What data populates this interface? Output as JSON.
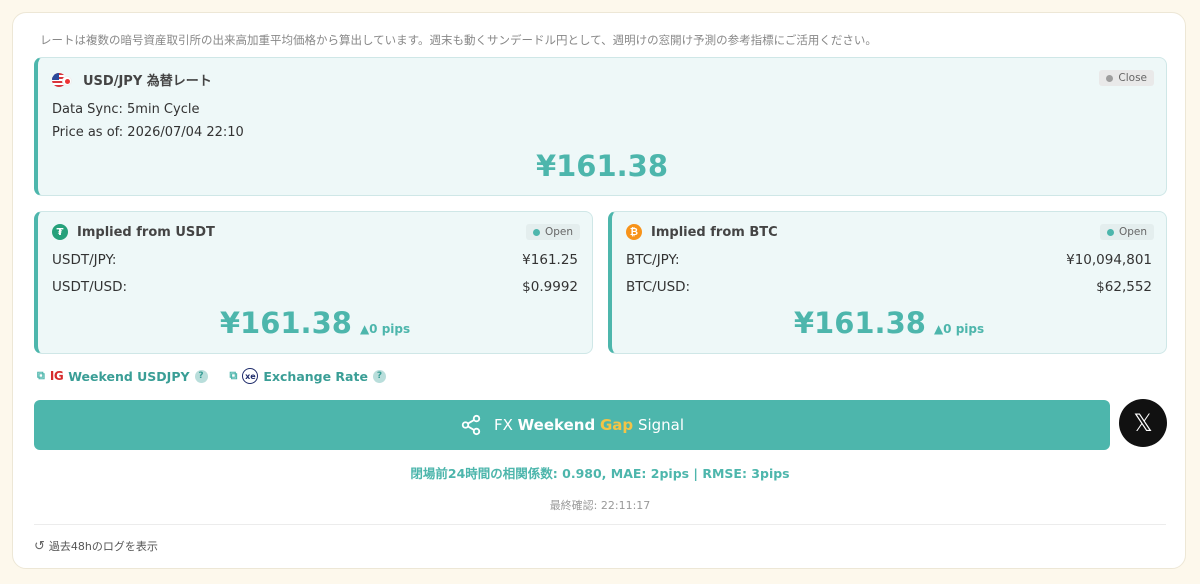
{
  "notice": "レートは複数の暗号資産取引所の出来高加重平均価格から算出しています。週末も動くサンデードル円として、週明けの窓開け予測の参考指標にご活用ください。",
  "main_card": {
    "title": "USD/JPY 為替レート",
    "badge": "Close",
    "sync": "Data Sync: 5min Cycle",
    "price_as_of": "Price as of: 2026/07/04 22:10",
    "price": "¥161.38"
  },
  "usdt_card": {
    "title": "Implied from USDT",
    "badge": "Open",
    "rows": [
      {
        "label": "USDT/JPY:",
        "value": "¥161.25"
      },
      {
        "label": "USDT/USD:",
        "value": "$0.9992"
      }
    ],
    "price": "¥161.38",
    "pips": "▲0 pips"
  },
  "btc_card": {
    "title": "Implied from BTC",
    "badge": "Open",
    "rows": [
      {
        "label": "BTC/JPY:",
        "value": "¥10,094,801"
      },
      {
        "label": "BTC/USD:",
        "value": "$62,552"
      }
    ],
    "price": "¥161.38",
    "pips": "▲0 pips"
  },
  "links": {
    "ig_logo": "IG",
    "ig_label": "Weekend USDJPY",
    "xe_logo": "xe",
    "xe_label": "Exchange Rate",
    "help": "?"
  },
  "signal_button": {
    "prefix": "FX",
    "weekend": "Weekend",
    "gap": "Gap",
    "suffix": "Signal"
  },
  "x_button": "𝕏",
  "stats": "閉場前24時間の相関係数: 0.980, MAE: 2pips | RMSE: 3pips",
  "last_check": "最終確認: 22:11:17",
  "log_link": "過去48hのログを表示",
  "colors": {
    "accent": "#4db6ac",
    "card_bg": "#eef8f8",
    "gap_highlight": "#f3c446",
    "page_bg": "#fdf8ec"
  }
}
